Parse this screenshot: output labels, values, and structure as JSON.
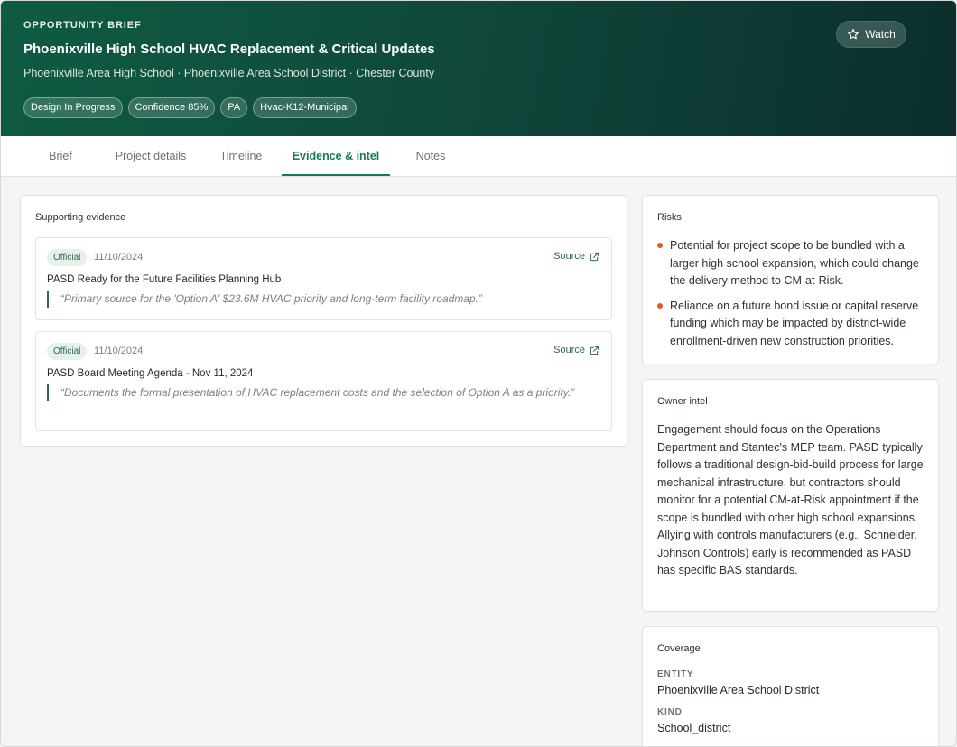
{
  "header": {
    "eyebrow": "OPPORTUNITY BRIEF",
    "title": "Phoenixville High School HVAC Replacement & Critical Updates",
    "subtitle": "Phoenixville Area High School · Phoenixville Area School District · Chester County",
    "chips": [
      "Design In Progress",
      "Confidence 85%",
      "PA",
      "Hvac-K12-Municipal"
    ],
    "watch_label": "Watch"
  },
  "tabs": [
    "Brief",
    "Project details",
    "Timeline",
    "Evidence & intel",
    "Notes"
  ],
  "active_tab": "Evidence & intel",
  "evidence": {
    "title": "Supporting evidence",
    "items": [
      {
        "badge": "Official",
        "date": "11/10/2024",
        "source_label": "Source",
        "name": "PASD Ready for the Future Facilities Planning Hub",
        "quote": "“Primary source for the 'Option A' $23.6M HVAC priority and long-term facility roadmap.”"
      },
      {
        "badge": "Official",
        "date": "11/10/2024",
        "source_label": "Source",
        "name": "PASD Board Meeting Agenda - Nov 11, 2024",
        "quote": "“Documents the formal presentation of HVAC replacement costs and the selection of Option A as a priority.”"
      }
    ]
  },
  "risks": {
    "title": "Risks",
    "items": [
      "Potential for project scope to be bundled with a larger high school expansion, which could change the delivery method to CM-at-Risk.",
      "Reliance on a future bond issue or capital reserve funding which may be impacted by district-wide enrollment-driven new construction priorities."
    ]
  },
  "owner_intel": {
    "title": "Owner intel",
    "text": "Engagement should focus on the Operations Department and Stantec's MEP team. PASD typically follows a traditional design-bid-build process for large mechanical infrastructure, but contractors should monitor for a potential CM-at-Risk appointment if the scope is bundled with other high school expansions. Allying with controls manufacturers (e.g., Schneider, Johnson Controls) early is recommended as PASD has specific BAS standards."
  },
  "coverage": {
    "title": "Coverage",
    "entity_label": "ENTITY",
    "entity_value": "Phoenixville Area School District",
    "kind_label": "KIND",
    "kind_value": "School_district"
  },
  "colors": {
    "brand": "#157a55",
    "risk_dot": "#e25a1c",
    "badge_bg": "#e5f2ea"
  },
  "icons": {
    "watch": "star-icon",
    "source": "external-link-icon"
  }
}
